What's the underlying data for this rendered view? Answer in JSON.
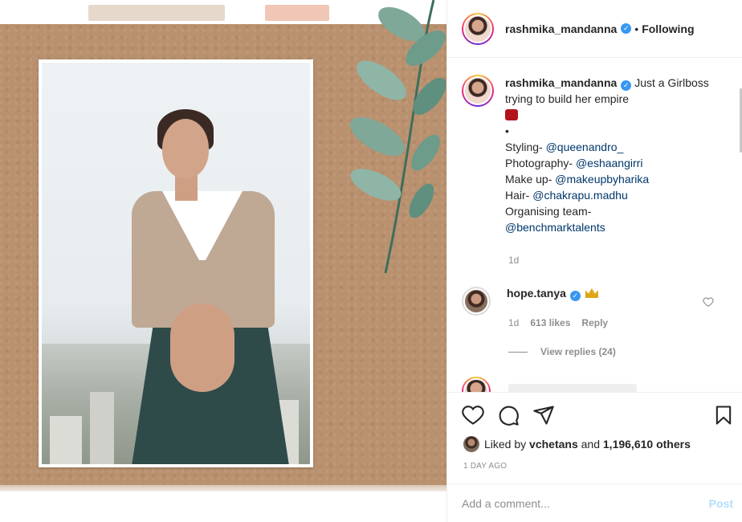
{
  "post": {
    "username": "rashmika_mandanna",
    "verified_badge": "✓",
    "separator": "•",
    "follow_status": "Following"
  },
  "caption": {
    "username": "rashmika_mandanna",
    "line1": "Just a Girlboss trying to build her empire",
    "bullet": "•",
    "credits": [
      {
        "label": "Styling- ",
        "mention": "@queenandro_"
      },
      {
        "label": "Photography- ",
        "mention": "@eshaangirri"
      },
      {
        "label": "Make up- ",
        "mention": "@makeupbyharika"
      },
      {
        "label": "Hair- ",
        "mention": "@chakrapu.madhu"
      },
      {
        "label": "Organising team- ",
        "mention": "@benchmarktalents"
      }
    ],
    "time": "1d"
  },
  "comment": {
    "username": "hope.tanya",
    "time": "1d",
    "likes": "613 likes",
    "reply": "Reply",
    "view_replies": "View replies (24)"
  },
  "actions": {
    "icons": [
      "heart-icon",
      "comment-icon",
      "share-icon",
      "bookmark-icon"
    ]
  },
  "likes": {
    "prefix": "Liked by ",
    "user": "vchetans",
    "middle": " and ",
    "count": "1,196,610 others"
  },
  "post_time": "1 DAY AGO",
  "add_comment": {
    "placeholder": "Add a comment...",
    "post_label": "Post"
  },
  "colors": {
    "mention": "#00376b",
    "verified": "#3897f0",
    "post_disabled": "#b2dffc"
  }
}
